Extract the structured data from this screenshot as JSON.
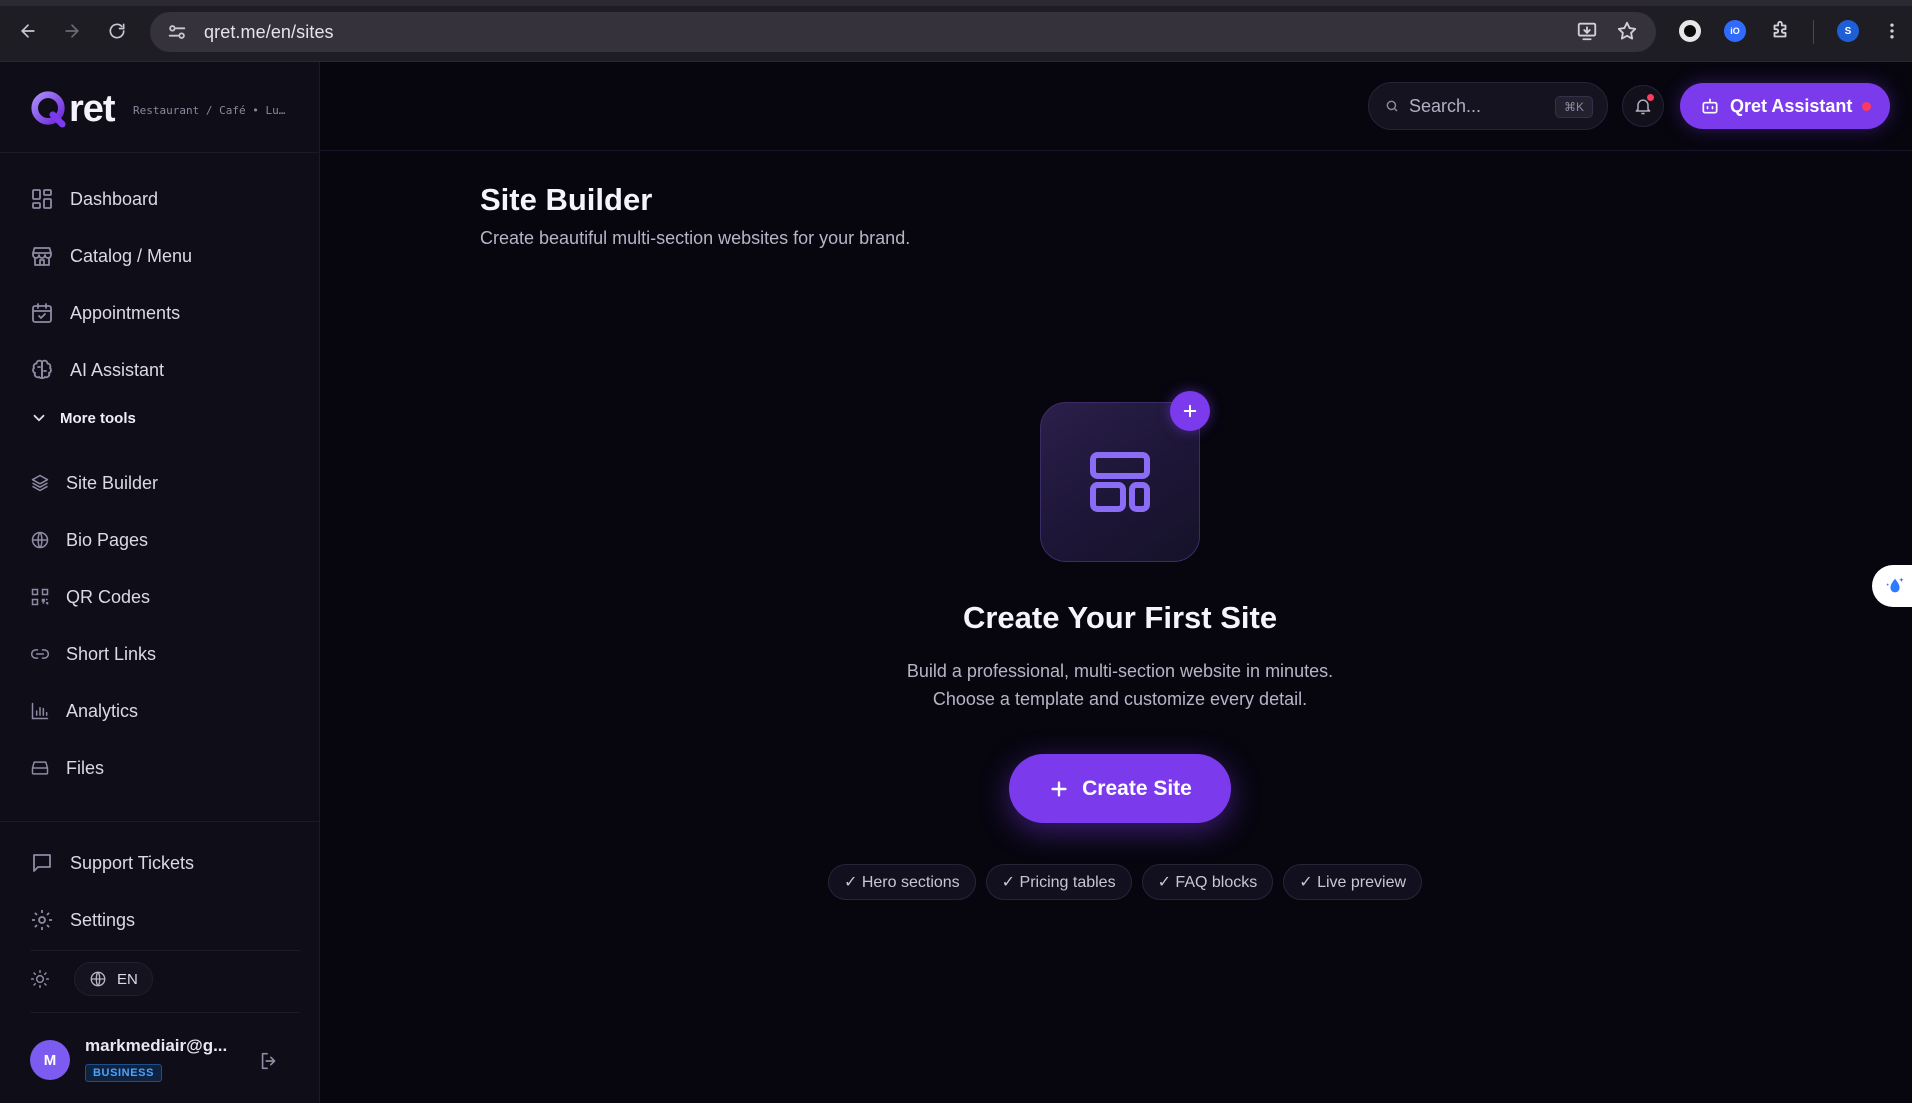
{
  "browser": {
    "url": "qret.me/en/sites",
    "profile_initial": "S",
    "extension_label": "iO"
  },
  "brand": {
    "name": "ret",
    "tagline": "Restaurant / Café • Lu…"
  },
  "sidebar": {
    "primary": [
      {
        "label": "Dashboard",
        "icon": "dashboard-icon"
      },
      {
        "label": "Catalog / Menu",
        "icon": "store-icon"
      },
      {
        "label": "Appointments",
        "icon": "calendar-check-icon"
      },
      {
        "label": "AI Assistant",
        "icon": "brain-icon"
      }
    ],
    "more_tools_label": "More tools",
    "more_tools": [
      {
        "label": "Site Builder",
        "icon": "layers-icon"
      },
      {
        "label": "Bio Pages",
        "icon": "globe-icon"
      },
      {
        "label": "QR Codes",
        "icon": "qr-code-icon"
      },
      {
        "label": "Short Links",
        "icon": "link-icon"
      },
      {
        "label": "Analytics",
        "icon": "bar-chart-icon"
      },
      {
        "label": "Files",
        "icon": "drive-icon"
      }
    ],
    "footer": [
      {
        "label": "Support Tickets",
        "icon": "message-square-icon"
      },
      {
        "label": "Settings",
        "icon": "gear-icon"
      }
    ],
    "language": "EN",
    "user": {
      "initial": "M",
      "email": "markmediair@g...",
      "plan": "BUSINESS"
    }
  },
  "header": {
    "search_placeholder": "Search...",
    "search_shortcut": "⌘K",
    "assistant_label": "Qret Assistant"
  },
  "main": {
    "title": "Site Builder",
    "subtitle": "Create beautiful multi-section websites for your brand.",
    "empty_state": {
      "title": "Create Your First Site",
      "description_line1": "Build a professional, multi-section website in minutes.",
      "description_line2": "Choose a template and customize every detail.",
      "cta": "Create Site",
      "features": [
        "✓ Hero sections",
        "✓ Pricing tables",
        "✓ FAQ blocks",
        "✓ Live preview"
      ]
    }
  },
  "colors": {
    "accent": "#7c3aed",
    "background": "#07060f",
    "sidebar": "#0e0d18",
    "badge_text": "#4aa3ff",
    "notification": "#ff3b5c"
  }
}
